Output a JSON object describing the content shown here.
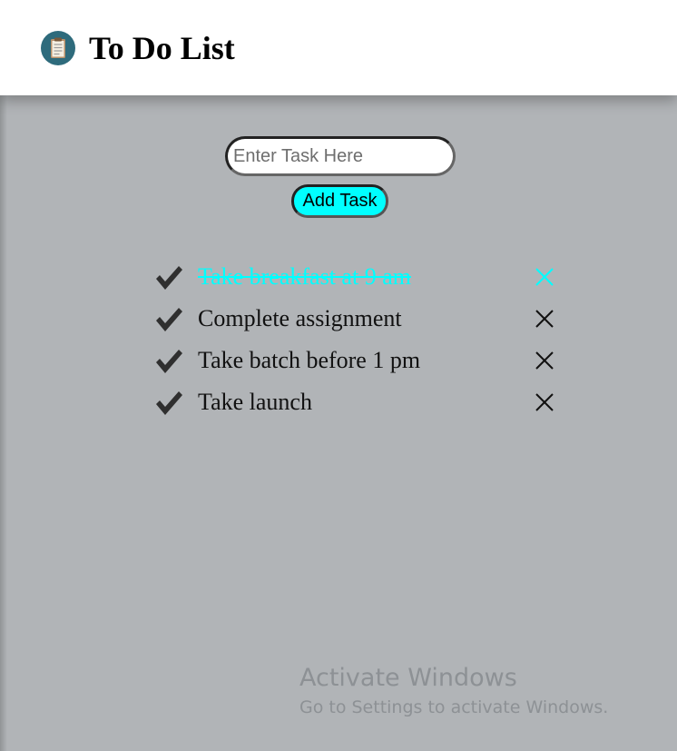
{
  "header": {
    "title": "To Do List",
    "logo_icon": "clipboard-icon"
  },
  "form": {
    "input_value": "",
    "input_placeholder": "Enter Task Here",
    "add_button_label": "Add Task"
  },
  "tasks": [
    {
      "text": "Take breakfast at 9 am",
      "completed": true
    },
    {
      "text": "Complete assignment",
      "completed": false
    },
    {
      "text": "Take batch before 1 pm",
      "completed": false
    },
    {
      "text": "Take launch",
      "completed": false
    }
  ],
  "watermark": {
    "title": "Activate Windows",
    "subtitle": "Go to Settings to activate Windows."
  },
  "colors": {
    "background": "#b1b4b7",
    "accent": "#00ffff",
    "header_bg": "#ffffff",
    "icon_dark": "#2f2f2f"
  }
}
